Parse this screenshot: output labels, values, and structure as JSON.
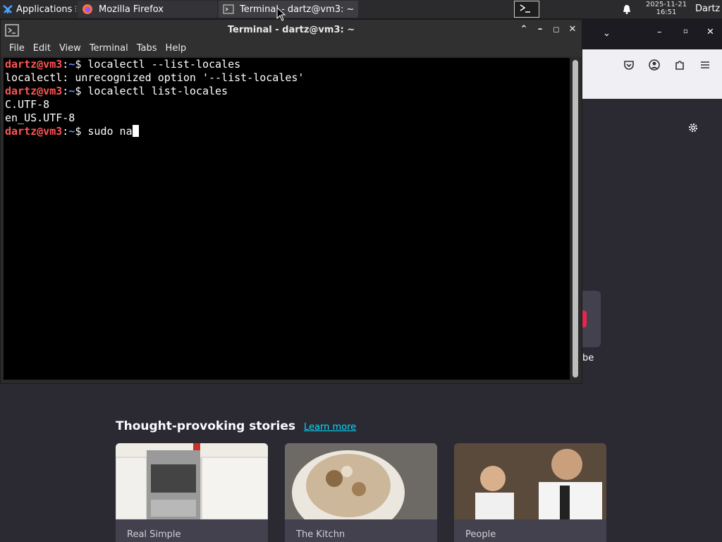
{
  "panel": {
    "applications_label": "Applications",
    "tasks": [
      {
        "label": "Mozilla Firefox",
        "icon": "firefox-icon"
      },
      {
        "label": "Terminal - dartz@vm3: ~",
        "icon": "terminal-icon"
      }
    ],
    "clock_date": "2025-11-21",
    "clock_time": "16:51",
    "user": "Dartz"
  },
  "terminal": {
    "title": "Terminal - dartz@vm3: ~",
    "menu": [
      "File",
      "Edit",
      "View",
      "Terminal",
      "Tabs",
      "Help"
    ],
    "prompt_user": "dartz@vm3",
    "prompt_path": "~",
    "prompt_symbol": "$",
    "lines": [
      {
        "type": "cmd",
        "text": " localectl --list-locales"
      },
      {
        "type": "out",
        "text": "localectl: unrecognized option '--list-locales'"
      },
      {
        "type": "cmd",
        "text": " localectl list-locales"
      },
      {
        "type": "out",
        "text": "C.UTF-8"
      },
      {
        "type": "out",
        "text": "en_US.UTF-8"
      },
      {
        "type": "cmd",
        "text": " sudo na",
        "cursor": true
      }
    ]
  },
  "firefox": {
    "shortcut_label_partial": "be",
    "stories_title": "Thought-provoking stories",
    "learn_more": "Learn more",
    "stories": [
      {
        "source": "Real Simple"
      },
      {
        "source": "The Kitchn"
      },
      {
        "source": "People"
      }
    ]
  },
  "colors": {
    "prompt_user": "#ff5555",
    "prompt_path": "#5c8aff",
    "link": "#00ddff"
  }
}
